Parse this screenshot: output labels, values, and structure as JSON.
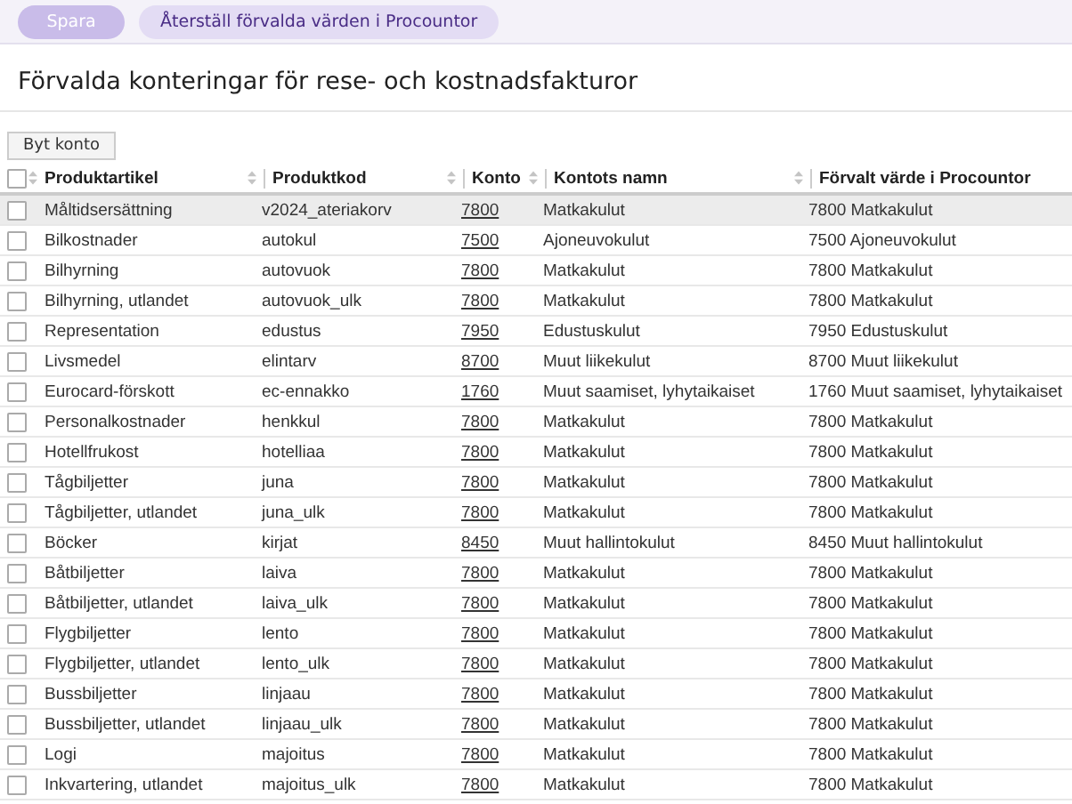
{
  "toolbar": {
    "buttons": [
      {
        "label": "Spara",
        "disabled": true
      },
      {
        "label": "Återställ förvalda värden i Procountor",
        "disabled": false
      }
    ]
  },
  "title": "Förvalda konteringar för rese- och kostnadsfakturor",
  "change_account_button": "Byt konto",
  "table": {
    "header_checked": false,
    "columns": [
      "Produktartikel",
      "Produktkod",
      "Konto",
      "Kontots namn",
      "Förvalt värde i Procountor"
    ],
    "rows": [
      {
        "checked": false,
        "highlighted": true,
        "cells": [
          "Måltidsersättning",
          "v2024_ateriakorv",
          "7800",
          "Matkakulut",
          "7800 Matkakulut"
        ]
      },
      {
        "checked": false,
        "highlighted": false,
        "cells": [
          "Bilkostnader",
          "autokul",
          "7500",
          "Ajoneuvokulut",
          "7500 Ajoneuvokulut"
        ]
      },
      {
        "checked": false,
        "highlighted": false,
        "cells": [
          "Bilhyrning",
          "autovuok",
          "7800",
          "Matkakulut",
          "7800 Matkakulut"
        ]
      },
      {
        "checked": false,
        "highlighted": false,
        "cells": [
          "Bilhyrning, utlandet",
          "autovuok_ulk",
          "7800",
          "Matkakulut",
          "7800 Matkakulut"
        ]
      },
      {
        "checked": false,
        "highlighted": false,
        "cells": [
          "Representation",
          "edustus",
          "7950",
          "Edustuskulut",
          "7950 Edustuskulut"
        ]
      },
      {
        "checked": false,
        "highlighted": false,
        "cells": [
          "Livsmedel",
          "elintarv",
          "8700",
          "Muut liikekulut",
          "8700 Muut liikekulut"
        ]
      },
      {
        "checked": false,
        "highlighted": false,
        "cells": [
          "Eurocard-förskott",
          "ec-ennakko",
          "1760",
          "Muut saamiset, lyhytaikaiset",
          "1760 Muut saamiset, lyhytaikaiset"
        ]
      },
      {
        "checked": false,
        "highlighted": false,
        "cells": [
          "Personalkostnader",
          "henkkul",
          "7800",
          "Matkakulut",
          "7800 Matkakulut"
        ]
      },
      {
        "checked": false,
        "highlighted": false,
        "cells": [
          "Hotellfrukost",
          "hotelliaa",
          "7800",
          "Matkakulut",
          "7800 Matkakulut"
        ]
      },
      {
        "checked": false,
        "highlighted": false,
        "cells": [
          "Tågbiljetter",
          "juna",
          "7800",
          "Matkakulut",
          "7800 Matkakulut"
        ]
      },
      {
        "checked": false,
        "highlighted": false,
        "cells": [
          "Tågbiljetter, utlandet",
          "juna_ulk",
          "7800",
          "Matkakulut",
          "7800 Matkakulut"
        ]
      },
      {
        "checked": false,
        "highlighted": false,
        "cells": [
          "Böcker",
          "kirjat",
          "8450",
          "Muut hallintokulut",
          "8450 Muut hallintokulut"
        ]
      },
      {
        "checked": false,
        "highlighted": false,
        "cells": [
          "Båtbiljetter",
          "laiva",
          "7800",
          "Matkakulut",
          "7800 Matkakulut"
        ]
      },
      {
        "checked": false,
        "highlighted": false,
        "cells": [
          "Båtbiljetter, utlandet",
          "laiva_ulk",
          "7800",
          "Matkakulut",
          "7800 Matkakulut"
        ]
      },
      {
        "checked": false,
        "highlighted": false,
        "cells": [
          "Flygbiljetter",
          "lento",
          "7800",
          "Matkakulut",
          "7800 Matkakulut"
        ]
      },
      {
        "checked": false,
        "highlighted": false,
        "cells": [
          "Flygbiljetter, utlandet",
          "lento_ulk",
          "7800",
          "Matkakulut",
          "7800 Matkakulut"
        ]
      },
      {
        "checked": false,
        "highlighted": false,
        "cells": [
          "Bussbiljetter",
          "linjaau",
          "7800",
          "Matkakulut",
          "7800 Matkakulut"
        ]
      },
      {
        "checked": false,
        "highlighted": false,
        "cells": [
          "Bussbiljetter, utlandet",
          "linjaau_ulk",
          "7800",
          "Matkakulut",
          "7800 Matkakulut"
        ]
      },
      {
        "checked": false,
        "highlighted": false,
        "cells": [
          "Logi",
          "majoitus",
          "7800",
          "Matkakulut",
          "7800 Matkakulut"
        ]
      },
      {
        "checked": false,
        "highlighted": false,
        "cells": [
          "Inkvartering, utlandet",
          "majoitus_ulk",
          "7800",
          "Matkakulut",
          "7800 Matkakulut"
        ]
      }
    ]
  }
}
